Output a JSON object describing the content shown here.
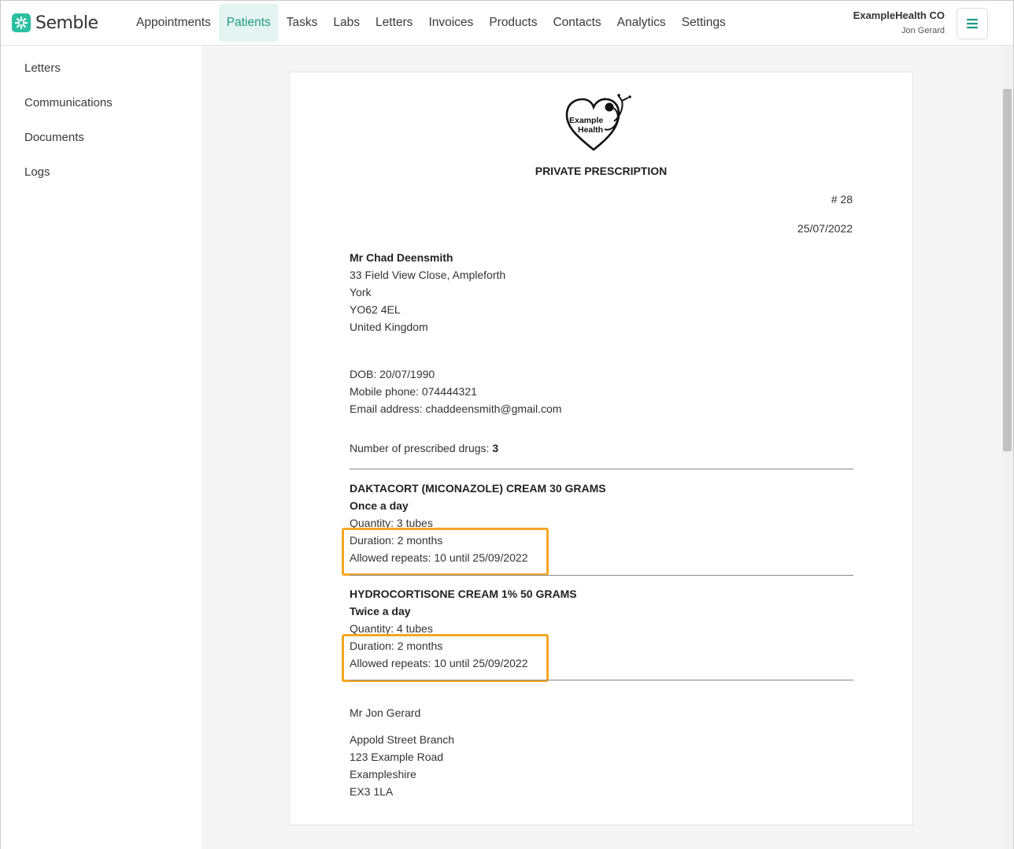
{
  "app": {
    "brand": "Semble",
    "org_name": "ExampleHealth CO",
    "user_name": "Jon Gerard",
    "brand_color": "#2bbfa1"
  },
  "nav": {
    "items": [
      {
        "label": "Appointments"
      },
      {
        "label": "Patients",
        "active": true
      },
      {
        "label": "Tasks"
      },
      {
        "label": "Labs"
      },
      {
        "label": "Letters"
      },
      {
        "label": "Invoices"
      },
      {
        "label": "Products"
      },
      {
        "label": "Contacts"
      },
      {
        "label": "Analytics"
      },
      {
        "label": "Settings"
      }
    ]
  },
  "sidebar": {
    "items": [
      {
        "label": "Letters"
      },
      {
        "label": "Communications"
      },
      {
        "label": "Documents"
      },
      {
        "label": "Logs"
      }
    ]
  },
  "prescription": {
    "logo_text": [
      "Example",
      "Health"
    ],
    "title": "PRIVATE PRESCRIPTION",
    "number": "# 28",
    "date": "25/07/2022",
    "patient": {
      "name": "Mr Chad Deensmith",
      "address": [
        "33 Field View Close, Ampleforth",
        "York",
        "YO62 4EL",
        "United Kingdom"
      ],
      "dob": "DOB: 20/07/1990",
      "mobile": "Mobile phone: 074444321",
      "email": "Email address: chaddeensmith@gmail.com"
    },
    "drug_count_label": "Number of prescribed drugs:",
    "drug_count": "3",
    "drugs": [
      {
        "name": "DAKTACORT (MICONAZOLE) CREAM 30 GRAMS",
        "frequency": "Once a day",
        "quantity": "Quantity: 3 tubes",
        "duration": "Duration: 2 months",
        "repeats": "Allowed repeats: 10 until 25/09/2022"
      },
      {
        "name": "HYDROCORTISONE CREAM 1% 50 GRAMS",
        "frequency": "Twice a day",
        "quantity": "Quantity: 4 tubes",
        "duration": "Duration: 2 months",
        "repeats": "Allowed repeats: 10 until 25/09/2022"
      }
    ],
    "prescriber": {
      "name": "Mr Jon Gerard",
      "address": [
        "Appold Street Branch",
        "123 Example Road",
        "Exampleshire",
        "EX3 1LA"
      ]
    },
    "highlight_color": "#f5a623"
  }
}
